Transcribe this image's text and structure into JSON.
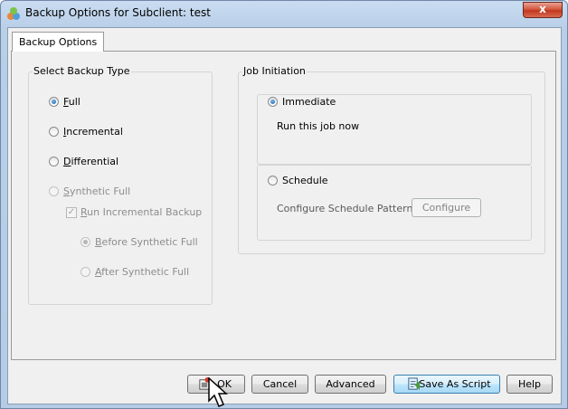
{
  "window": {
    "title": "Backup Options for Subclient: test",
    "close_label": "x"
  },
  "tabs": [
    {
      "label": "Backup Options",
      "selected": true
    }
  ],
  "backup_type": {
    "title": "Select Backup Type",
    "full": {
      "key": "F",
      "rest": "ull",
      "checked": true,
      "enabled": true
    },
    "incremental": {
      "key": "I",
      "rest": "ncremental",
      "checked": false,
      "enabled": true
    },
    "differential": {
      "key": "D",
      "rest": "ifferential",
      "checked": false,
      "enabled": true
    },
    "synthetic_full": {
      "key": "S",
      "rest": "ynthetic Full",
      "checked": false,
      "enabled": false
    },
    "run_incremental": {
      "key": "R",
      "rest": "un Incremental Backup",
      "checked": true,
      "enabled": false
    },
    "before_synthetic": {
      "key": "B",
      "rest": "efore Synthetic Full",
      "checked": true,
      "enabled": false
    },
    "after_synthetic": {
      "key": "A",
      "rest": "fter Synthetic Full",
      "checked": false,
      "enabled": false
    }
  },
  "job_initiation": {
    "title": "Job Initiation",
    "immediate": {
      "label": "Immediate",
      "checked": true
    },
    "immediate_desc": "Run this job now",
    "schedule": {
      "label": "Schedule",
      "checked": false
    },
    "schedule_desc": "Configure Schedule Pattern",
    "configure_label": "Configure"
  },
  "buttons": {
    "ok": "OK",
    "cancel": "Cancel",
    "advanced": "Advanced",
    "save_as_script": "Save As Script",
    "help": "Help"
  },
  "icons": {
    "app": "subclient-app-icon",
    "ok": "ok-button-icon",
    "script": "save-script-icon"
  }
}
